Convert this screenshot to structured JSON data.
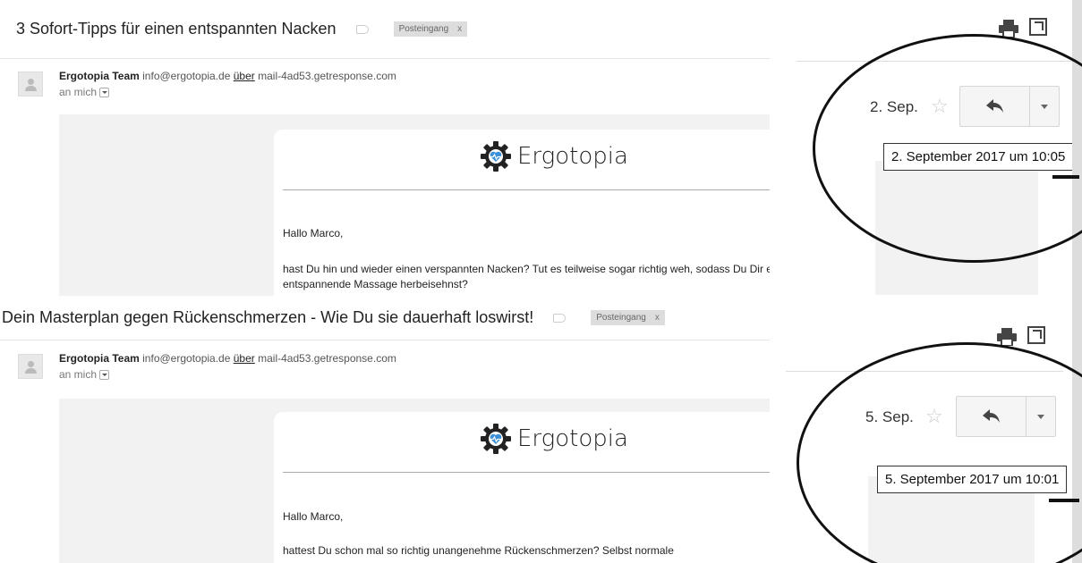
{
  "emails": [
    {
      "subject": "3 Sofort-Tipps für einen entspannten Nacken",
      "label": "Posteingang",
      "label_close": "x",
      "sender_name": "Ergotopia Team",
      "sender_email": "info@ergotopia.de",
      "via_word": "über",
      "via_domain": "mail-4ad53.getresponse.com",
      "to": "an mich",
      "brand": "Ergotopia",
      "greeting": "Hallo Marco,",
      "body": "hast Du hin und wieder einen verspannten Nacken? Tut es teilweise sogar richtig weh, sodass Du Dir eine entspannende Massage herbeisehnst?",
      "date_short": "2. Sep.",
      "date_full": "2. September 2017 um 10:05"
    },
    {
      "subject": "Dein Masterplan gegen Rückenschmerzen - Wie Du sie dauerhaft loswirst!",
      "label": "Posteingang",
      "label_close": "x",
      "sender_name": "Ergotopia Team",
      "sender_email": "info@ergotopia.de",
      "via_word": "über",
      "via_domain": "mail-4ad53.getresponse.com",
      "to": "an mich",
      "brand": "Ergotopia",
      "greeting": "Hallo Marco,",
      "body": "hattest Du schon mal so richtig unangenehme Rückenschmerzen? Selbst normale",
      "date_short": "5. Sep.",
      "date_full": "5. September 2017 um 10:01"
    }
  ],
  "icons": {
    "star": "☆",
    "reply": "reply-arrow-icon",
    "more": "chevron-down-icon",
    "print": "print-icon",
    "popout": "popout-icon"
  },
  "colors": {
    "brand_dark": "#222222",
    "brand_heart": "#3a8fd8",
    "annotation": "#111111"
  }
}
